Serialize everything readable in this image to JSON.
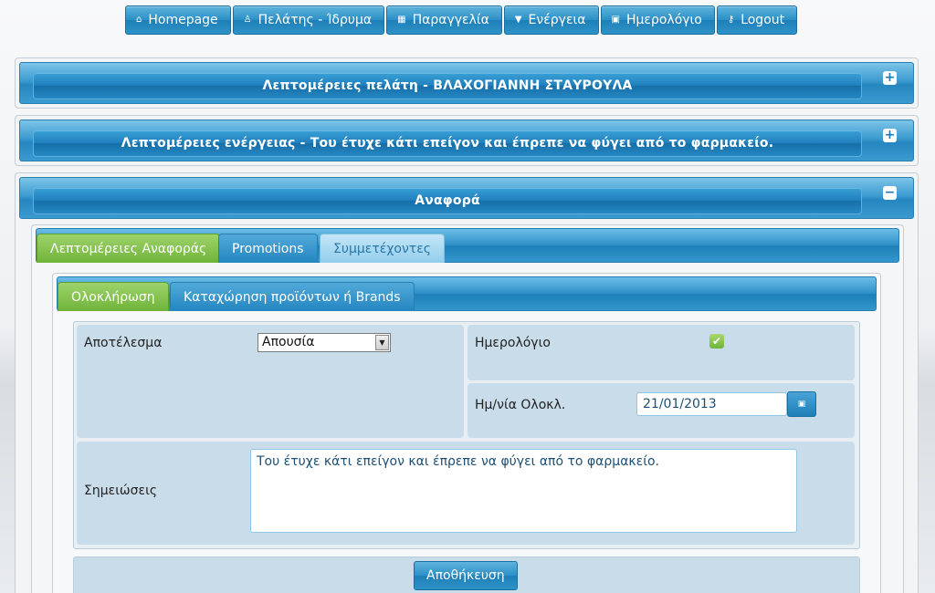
{
  "nav": {
    "items": [
      {
        "label": "Homepage",
        "icon": "home-icon",
        "glyph": "⌂"
      },
      {
        "label": "Πελάτης - Ίδρυμα",
        "icon": "user-icon",
        "glyph": "♙"
      },
      {
        "label": "Παραγγελία",
        "icon": "cart-icon",
        "glyph": "▦"
      },
      {
        "label": "Ενέργεια",
        "icon": "caret-down-icon",
        "glyph": "▼"
      },
      {
        "label": "Ημερολόγιο",
        "icon": "calendar-icon",
        "glyph": "▣"
      },
      {
        "label": "Logout",
        "icon": "key-icon",
        "glyph": "⚷"
      }
    ]
  },
  "panels": {
    "client": {
      "title": "Λεπτομέρειες πελάτη - ΒΛΑΧΟΓΙΑΝΝΗ ΣΤΑΥΡΟΥΛΑ",
      "toggle": "+"
    },
    "action": {
      "title": "Λεπτομέρειες ενέργειας - Του έτυχε κάτι επείγον και έπρεπε να φύγει από το φαρμακείο.",
      "toggle": "+"
    },
    "report": {
      "title": "Αναφορά",
      "toggle": "−"
    }
  },
  "tabs": {
    "outer": [
      "Λεπτομέρειες Αναφοράς",
      "Promotions",
      "Συμμετέχοντες"
    ],
    "inner": [
      "Ολοκλήρωση",
      "Καταχώρηση προϊόντων ή Brands"
    ]
  },
  "form": {
    "result_label": "Αποτέλεσμα",
    "result_value": "Απουσία",
    "calendar_label": "Ημερολόγιο",
    "calendar_checked": "✔",
    "date_label": "Ημ/νία Ολοκλ.",
    "date_value": "21/01/2013",
    "notes_label": "Σημειώσεις",
    "notes_value": "Του έτυχε κάτι επείγον και έπρεπε να φύγει από το φαρμακείο.",
    "save_label": "Αποθήκευση"
  },
  "colors": {
    "accent_blue": "#2686c0",
    "active_tab_green": "#6fb43a",
    "field_bg": "#c9dcea"
  }
}
